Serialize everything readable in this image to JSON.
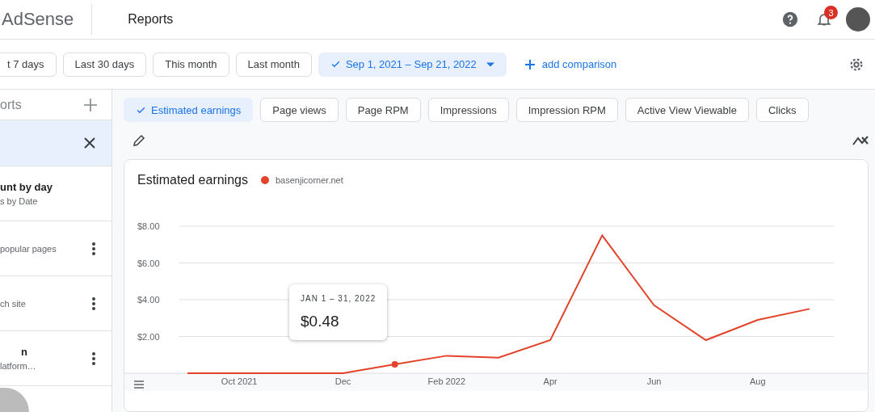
{
  "header": {
    "brand": "AdSense",
    "title": "Reports",
    "notification_count": "3"
  },
  "date_filters": [
    {
      "label": "t 7 days",
      "selected": false
    },
    {
      "label": "Last 30 days",
      "selected": false
    },
    {
      "label": "This month",
      "selected": false
    },
    {
      "label": "Last month",
      "selected": false
    },
    {
      "label": "Sep 1, 2021 – Sep 21, 2022",
      "selected": true
    }
  ],
  "add_comparison": "add comparison",
  "sidebar": {
    "title": "orts",
    "items": [
      {
        "kind": "active"
      },
      {
        "kind": "plain",
        "title": "unt by day",
        "subtitle": "s by Date"
      },
      {
        "kind": "menu",
        "subtitle": "popular pages"
      },
      {
        "kind": "menu",
        "subtitle": "ch site"
      },
      {
        "kind": "menu",
        "title": "n",
        "subtitle": "latform…"
      }
    ]
  },
  "metrics": [
    {
      "label": "Estimated earnings",
      "selected": true
    },
    {
      "label": "Page views",
      "selected": false
    },
    {
      "label": "Page RPM",
      "selected": false
    },
    {
      "label": "Impressions",
      "selected": false
    },
    {
      "label": "Impression RPM",
      "selected": false
    },
    {
      "label": "Active View Viewable",
      "selected": false
    },
    {
      "label": "Clicks",
      "selected": false
    }
  ],
  "chart": {
    "title": "Estimated earnings",
    "tooltip": {
      "date": "JAN 1 – 31, 2022",
      "value": "$0.48"
    },
    "chart_data": {
      "type": "line",
      "grid": true,
      "categories": [
        null,
        "Oct 2021",
        null,
        "Dec",
        null,
        "Feb 2022",
        null,
        "Apr",
        null,
        "Jun",
        null,
        "Aug",
        null
      ],
      "series": [
        {
          "name": "basenjicorner.net",
          "color": "#e2432a",
          "values": [
            0,
            0,
            0,
            0,
            0.48,
            0.95,
            0.85,
            1.8,
            7.5,
            3.7,
            1.8,
            2.9,
            3.5
          ]
        }
      ],
      "ylim": [
        0,
        8
      ],
      "yticks": [
        {
          "value": 2,
          "label": "$2.00"
        },
        {
          "value": 4,
          "label": "$4.00"
        },
        {
          "value": 6,
          "label": "$6.00"
        },
        {
          "value": 8,
          "label": "$8.00"
        }
      ]
    }
  }
}
